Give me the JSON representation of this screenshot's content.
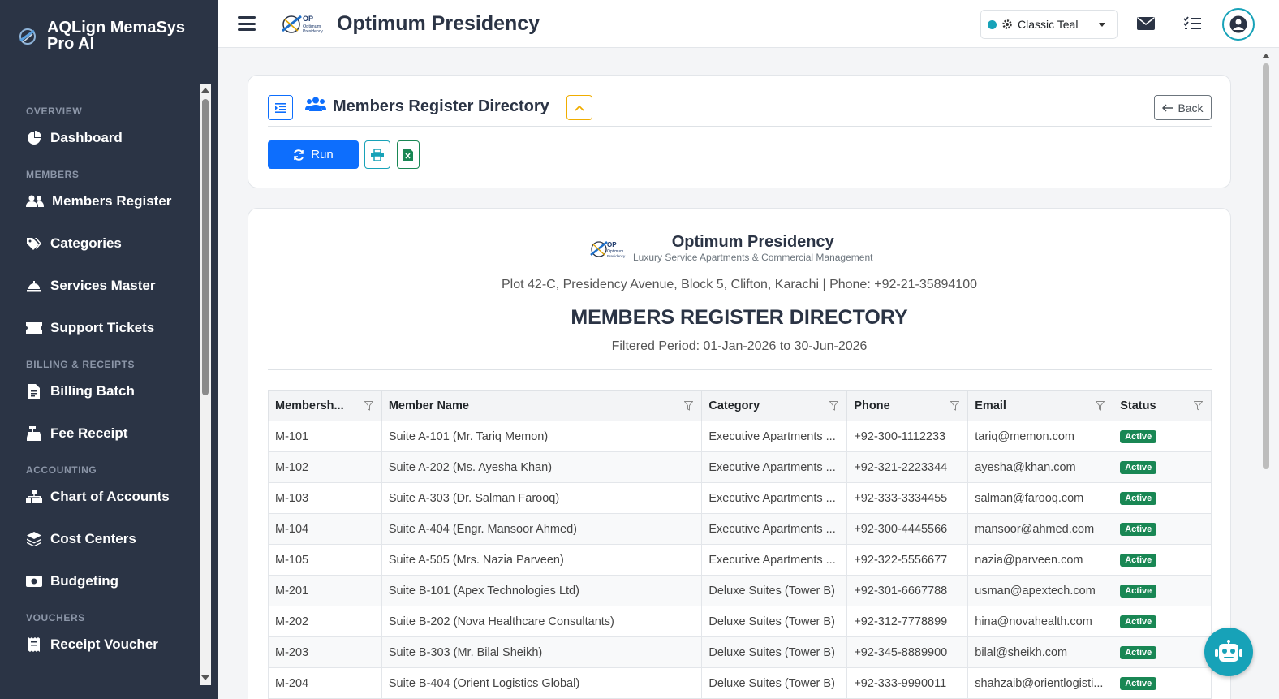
{
  "app": {
    "brand": "AQLign MemaSys Pro AI",
    "org_title": "Optimum Presidency"
  },
  "topbar": {
    "theme_label": "Classic Teal"
  },
  "sidebar": {
    "sections": [
      {
        "label": "OVERVIEW",
        "items": [
          {
            "label": "Dashboard",
            "icon": "chart-pie-icon"
          }
        ]
      },
      {
        "label": "MEMBERS",
        "items": [
          {
            "label": "Members Register",
            "icon": "users-icon"
          },
          {
            "label": "Categories",
            "icon": "tags-icon"
          },
          {
            "label": "Services Master",
            "icon": "bell-concierge-icon"
          },
          {
            "label": "Support Tickets",
            "icon": "ticket-icon"
          }
        ]
      },
      {
        "label": "BILLING & RECEIPTS",
        "items": [
          {
            "label": "Billing Batch",
            "icon": "file-invoice-icon"
          },
          {
            "label": "Fee Receipt",
            "icon": "cash-register-icon"
          }
        ]
      },
      {
        "label": "ACCOUNTING",
        "items": [
          {
            "label": "Chart of Accounts",
            "icon": "sitemap-icon"
          },
          {
            "label": "Cost Centers",
            "icon": "layer-group-icon"
          },
          {
            "label": "Budgeting",
            "icon": "money-bill-icon"
          }
        ]
      },
      {
        "label": "VOUCHERS",
        "items": [
          {
            "label": "Receipt Voucher",
            "icon": "receipt-icon"
          }
        ]
      }
    ]
  },
  "panel": {
    "title": "Members Register Directory",
    "back_label": "Back",
    "run_label": "Run"
  },
  "report": {
    "org": "Optimum Presidency",
    "tagline": "Luxury Service Apartments & Commercial Management",
    "address": "Plot 42-C, Presidency Avenue, Block 5, Clifton, Karachi | Phone: +92-21-35894100",
    "title": "MEMBERS REGISTER DIRECTORY",
    "period": "Filtered Period: 01-Jan-2026 to 30-Jun-2026"
  },
  "table": {
    "columns": [
      "Membersh...",
      "Member Name",
      "Category",
      "Phone",
      "Email",
      "Status"
    ],
    "rows": [
      [
        "M-101",
        "Suite A-101 (Mr. Tariq Memon)",
        "Executive Apartments ...",
        "+92-300-1112233",
        "tariq@memon.com",
        "Active"
      ],
      [
        "M-102",
        "Suite A-202 (Ms. Ayesha Khan)",
        "Executive Apartments ...",
        "+92-321-2223344",
        "ayesha@khan.com",
        "Active"
      ],
      [
        "M-103",
        "Suite A-303 (Dr. Salman Farooq)",
        "Executive Apartments ...",
        "+92-333-3334455",
        "salman@farooq.com",
        "Active"
      ],
      [
        "M-104",
        "Suite A-404 (Engr. Mansoor Ahmed)",
        "Executive Apartments ...",
        "+92-300-4445566",
        "mansoor@ahmed.com",
        "Active"
      ],
      [
        "M-105",
        "Suite A-505 (Mrs. Nazia Parveen)",
        "Executive Apartments ...",
        "+92-322-5556677",
        "nazia@parveen.com",
        "Active"
      ],
      [
        "M-201",
        "Suite B-101 (Apex Technologies Ltd)",
        "Deluxe Suites (Tower B)",
        "+92-301-6667788",
        "usman@apextech.com",
        "Active"
      ],
      [
        "M-202",
        "Suite B-202 (Nova Healthcare Consultants)",
        "Deluxe Suites (Tower B)",
        "+92-312-7778899",
        "hina@novahealth.com",
        "Active"
      ],
      [
        "M-203",
        "Suite B-303 (Mr. Bilal Sheikh)",
        "Deluxe Suites (Tower B)",
        "+92-345-8889900",
        "bilal@sheikh.com",
        "Active"
      ],
      [
        "M-204",
        "Suite B-404 (Orient Logistics Global)",
        "Deluxe Suites (Tower B)",
        "+92-333-9990011",
        "shahzaib@orientlogisti...",
        "Active"
      ]
    ]
  },
  "colors": {
    "sidebar": "#2b3445",
    "primary": "#0d6efd",
    "accent": "#17a2b8",
    "success": "#198754"
  }
}
